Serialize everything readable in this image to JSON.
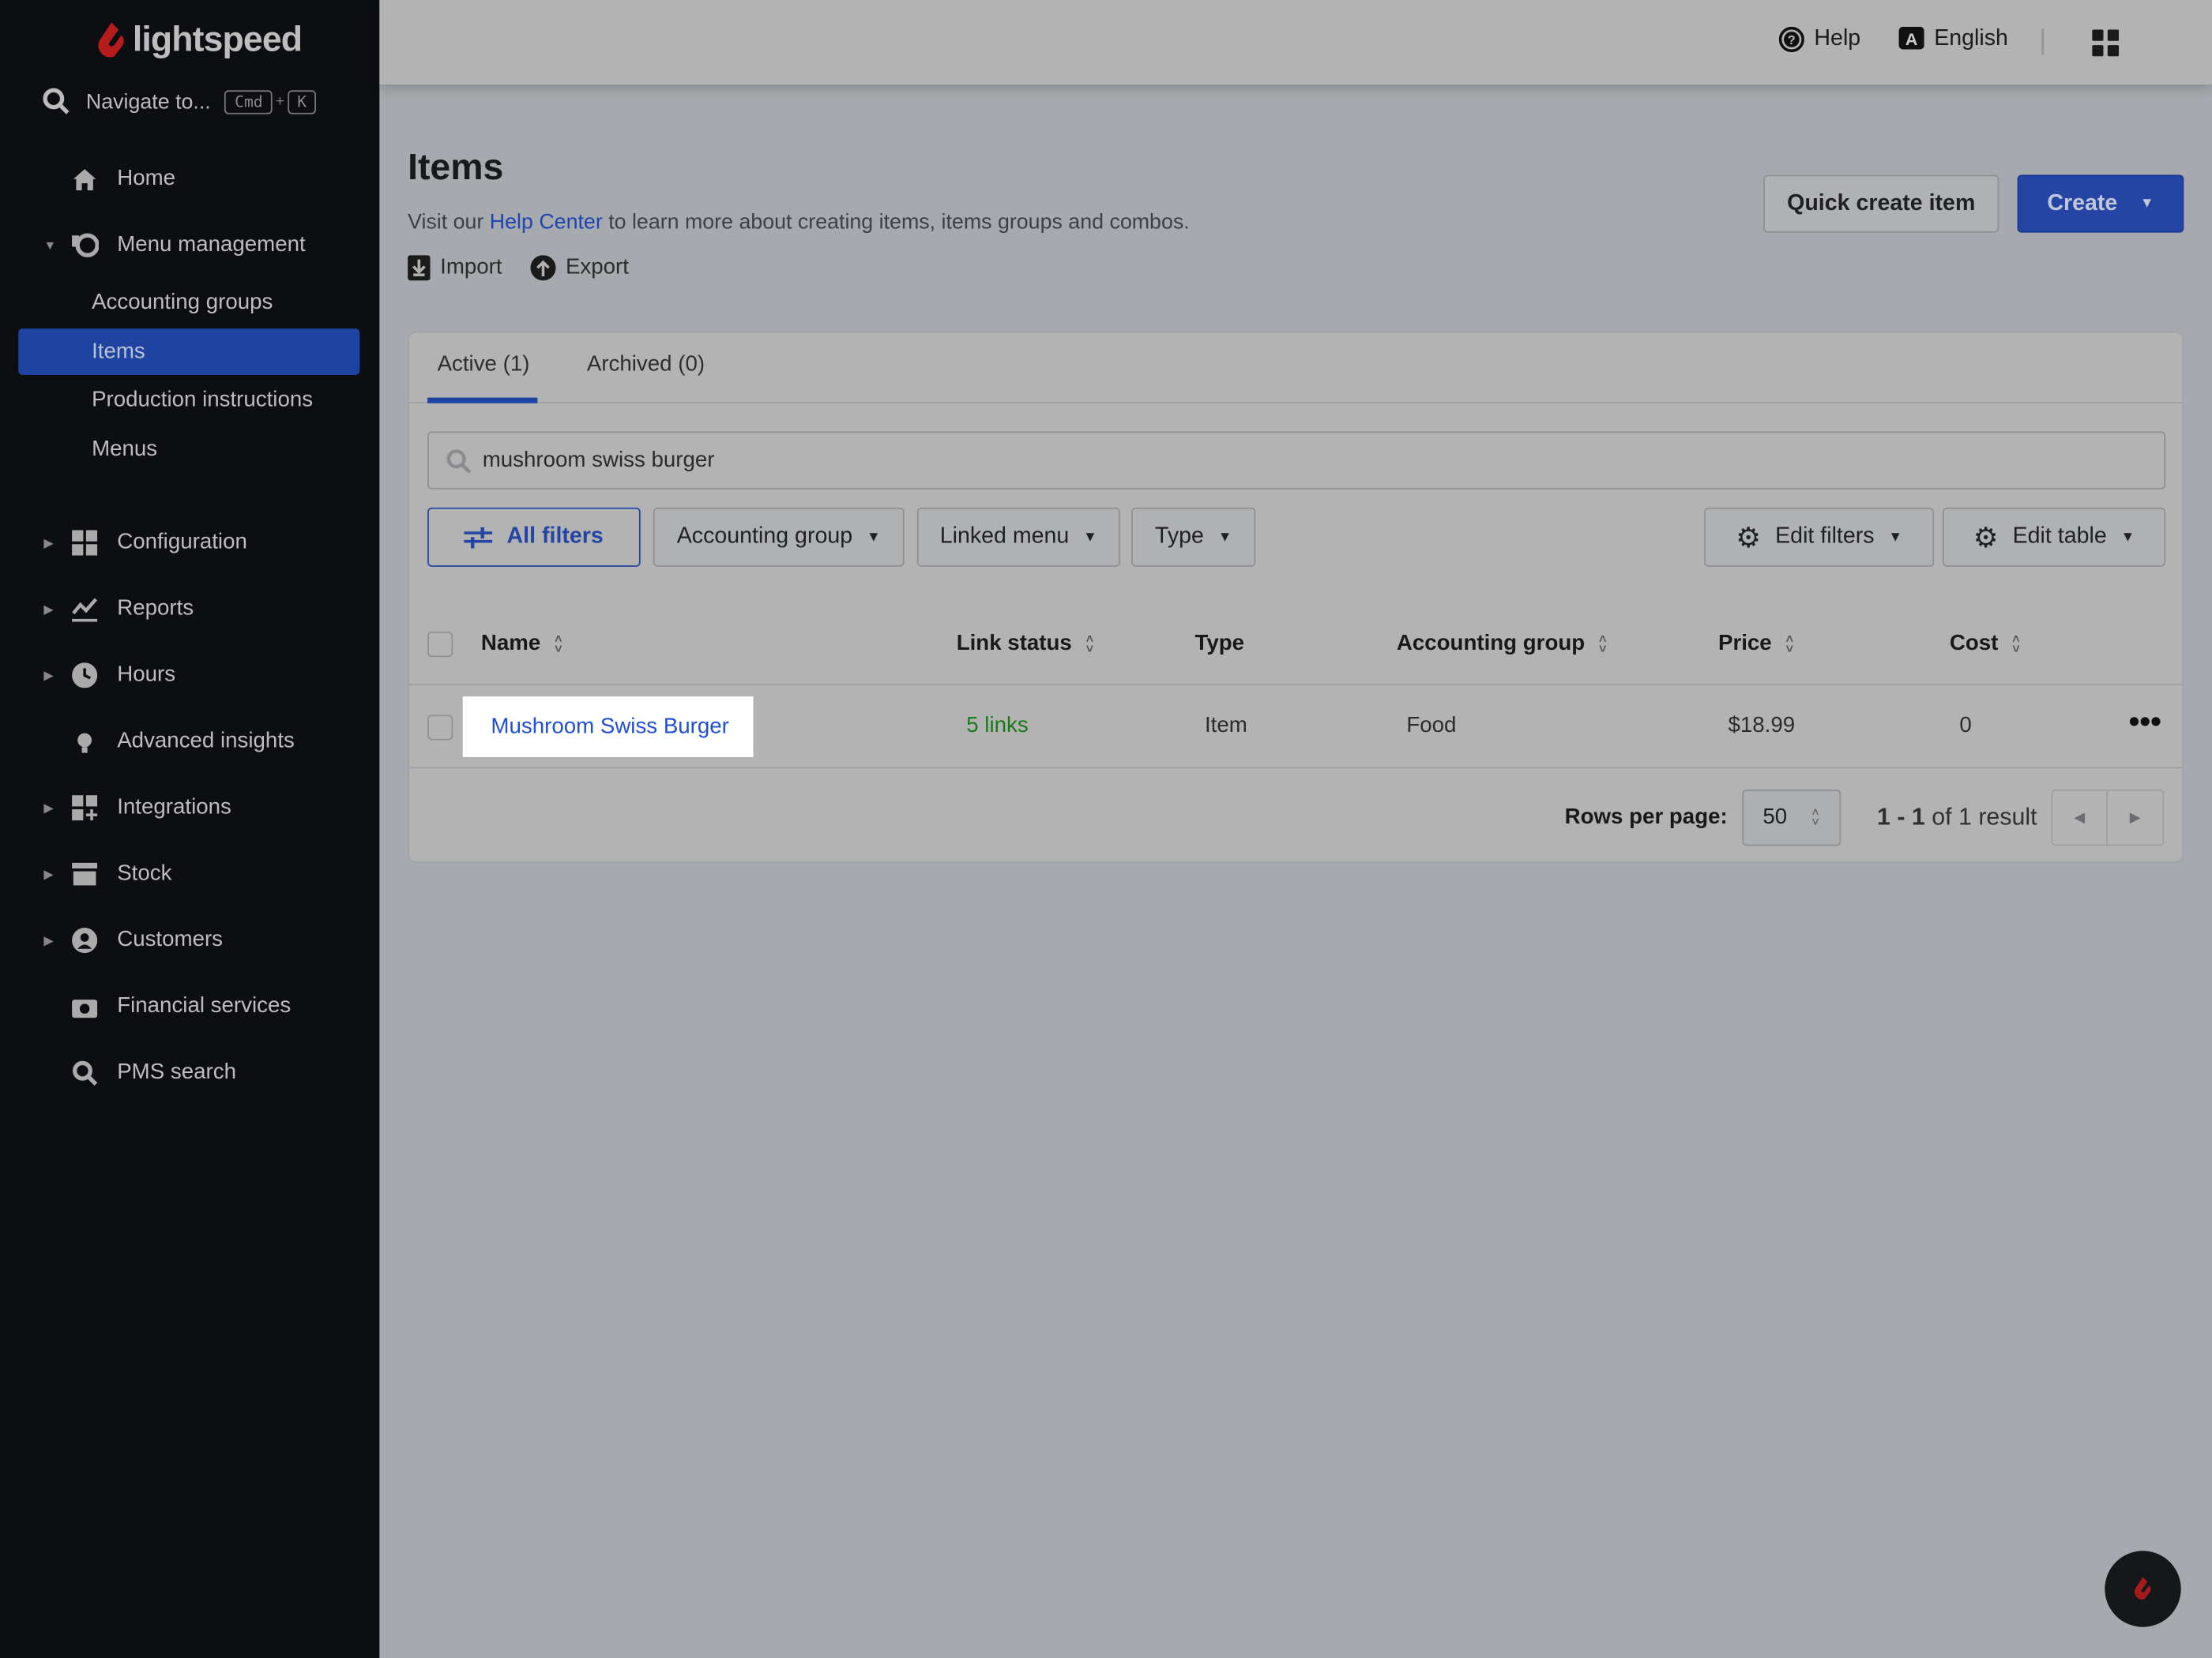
{
  "brand": {
    "name": "lightspeed",
    "accent": "#c41e1e"
  },
  "sidebar": {
    "search": {
      "label": "Navigate to...",
      "key1": "Cmd",
      "plus": "+",
      "key2": "K"
    },
    "items": [
      {
        "label": "Home",
        "icon": "home-icon"
      },
      {
        "label": "Menu management",
        "icon": "menu-management-icon",
        "expanded": true,
        "children": [
          {
            "label": "Accounting groups"
          },
          {
            "label": "Items",
            "active": true
          },
          {
            "label": "Production instructions"
          },
          {
            "label": "Menus"
          }
        ]
      },
      {
        "label": "Configuration",
        "icon": "configuration-icon"
      },
      {
        "label": "Reports",
        "icon": "reports-icon"
      },
      {
        "label": "Hours",
        "icon": "clock-icon"
      },
      {
        "label": "Advanced insights",
        "icon": "lightbulb-icon"
      },
      {
        "label": "Integrations",
        "icon": "integrations-icon"
      },
      {
        "label": "Stock",
        "icon": "stock-icon"
      },
      {
        "label": "Customers",
        "icon": "user-icon"
      },
      {
        "label": "Financial services",
        "icon": "camera-icon"
      },
      {
        "label": "PMS search",
        "icon": "search-icon"
      }
    ]
  },
  "topbar": {
    "help": "Help",
    "language": "English"
  },
  "page": {
    "title": "Items",
    "subtitle_pre": "Visit our ",
    "subtitle_link": "Help Center",
    "subtitle_post": " to learn more about creating items, items groups and combos.",
    "import": "Import",
    "export": "Export",
    "quick_create": "Quick create item",
    "create": "Create"
  },
  "tabs": [
    {
      "label": "Active (1)",
      "active": true
    },
    {
      "label": "Archived (0)"
    }
  ],
  "search": {
    "value": "mushroom swiss burger"
  },
  "filters": {
    "all": "All filters",
    "accounting_group": "Accounting group",
    "linked_menu": "Linked menu",
    "type": "Type",
    "edit_filters": "Edit filters",
    "edit_table": "Edit table"
  },
  "table": {
    "columns": [
      "Name",
      "Link status",
      "Type",
      "Accounting group",
      "Price",
      "Cost"
    ],
    "rows": [
      {
        "name": "Mushroom Swiss Burger",
        "link_status": "5 links",
        "type": "Item",
        "accounting_group": "Food",
        "price": "$18.99",
        "cost": "0"
      }
    ]
  },
  "pagination": {
    "rows_per_page_label": "Rows per page:",
    "rows_per_page": "50",
    "range": "1 - 1",
    "of_text": "of 1 result"
  },
  "colors": {
    "primary": "#1e43a0",
    "link": "#1f4fd6",
    "link_status": "#1a7a1a"
  }
}
